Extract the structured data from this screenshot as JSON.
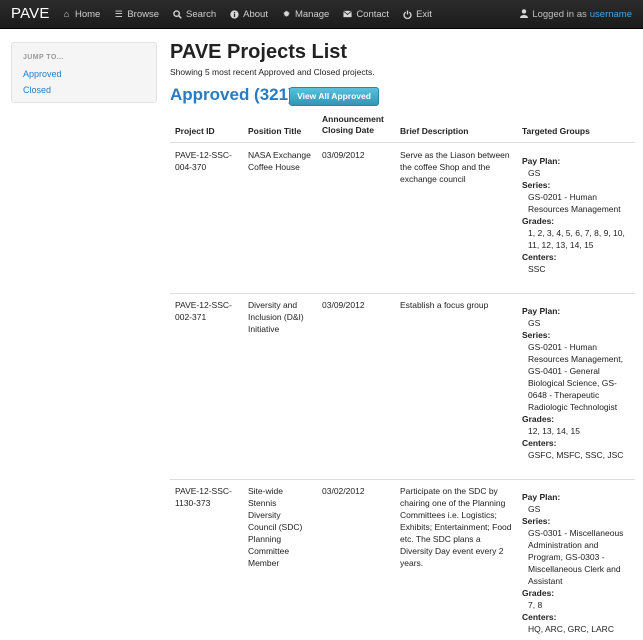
{
  "navbar": {
    "brand": "PAVE",
    "items": [
      {
        "label": "Home",
        "icon": "home-icon"
      },
      {
        "label": "Browse",
        "icon": "list-icon"
      },
      {
        "label": "Search",
        "icon": "search-icon"
      },
      {
        "label": "About",
        "icon": "info-icon"
      },
      {
        "label": "Manage",
        "icon": "gear-icon"
      },
      {
        "label": "Contact",
        "icon": "envelope-icon"
      },
      {
        "label": "Exit",
        "icon": "power-icon"
      }
    ],
    "logged_in_text": "Logged in as",
    "username": "username"
  },
  "sidebar": {
    "header": "JUMP TO...",
    "links": [
      "Approved",
      "Closed"
    ]
  },
  "main": {
    "title": "PAVE Projects List",
    "subtitle": "Showing 5 most recent Approved and Closed projects.",
    "section_title": "Approved (321)",
    "view_all_button": "View All Approved"
  },
  "table": {
    "headers": {
      "project_id": "Project ID",
      "position_title": "Position Title",
      "closing_date_1": "Announcement",
      "closing_date_2": "Closing Date",
      "description": "Brief Description",
      "targeted_groups": "Targeted Groups"
    },
    "labels": {
      "pay_plan": "Pay Plan:",
      "series": "Series:",
      "grades": "Grades:",
      "centers": "Centers:"
    },
    "rows": [
      {
        "id": "PAVE-12-SSC-004-370",
        "title": "NASA Exchange Coffee House",
        "date": "03/09/2012",
        "description": "Serve as the Liason between the coffee Shop and the exchange council",
        "pay_plan": "GS",
        "series": "GS-0201 - Human Resources Management",
        "grades": "1, 2, 3, 4, 5, 6, 7, 8, 9, 10, 11, 12, 13, 14, 15",
        "centers": "SSC"
      },
      {
        "id": "PAVE-12-SSC-002-371",
        "title": "Diversity and Inclusion (D&I) Initiative",
        "date": "03/09/2012",
        "description": "Establish a focus group",
        "pay_plan": "GS",
        "series": "GS-0201 - Human Resources Management, GS-0401 - General Biological Science, GS-0648 - Therapeutic Radiologic Technologist",
        "grades": "12, 13, 14, 15",
        "centers": "GSFC, MSFC, SSC, JSC"
      },
      {
        "id": "PAVE-12-SSC-1130-373",
        "title": "Site-wide Stennis Diversity Council (SDC) Planning Committee Member",
        "date": "03/02/2012",
        "description": "Participate on the SDC by chairing one of the Planning Committees i.e. Logistics; Exhibits; Entertainment; Food etc. The SDC plans a Diversity Day event every 2 years.",
        "pay_plan": "GS",
        "series": "GS-0301 - Miscellaneous Administration and Program, GS-0303 - Miscellaneous Clerk and Assistant",
        "grades": "7, 8",
        "centers": "HQ, ARC, GRC, LARC"
      }
    ]
  }
}
